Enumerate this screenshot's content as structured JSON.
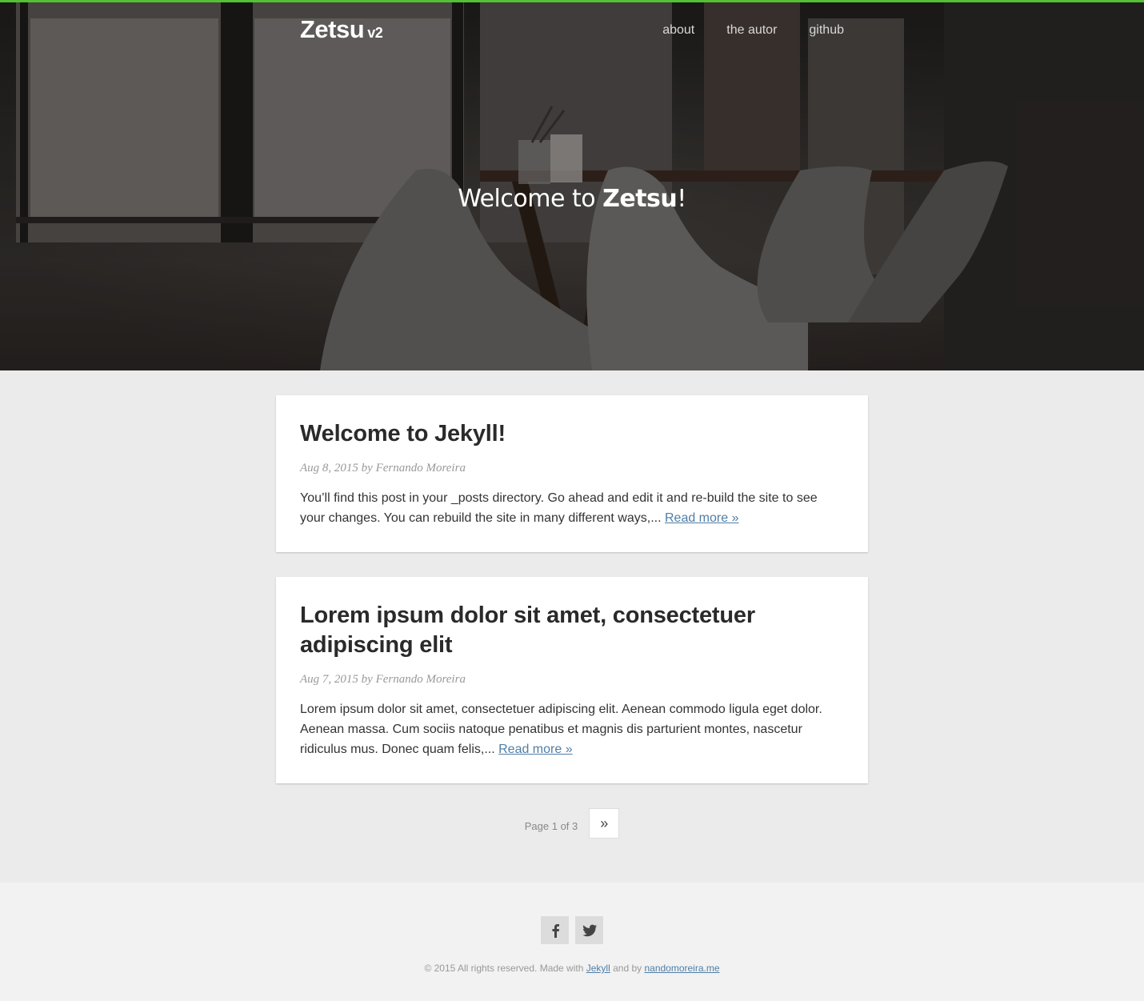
{
  "header": {
    "brand_name": "Zetsu",
    "brand_version": "v2",
    "nav": [
      "about",
      "the autor",
      "github"
    ]
  },
  "hero": {
    "prefix": "Welcome to ",
    "name": "Zetsu",
    "suffix": "!"
  },
  "posts": [
    {
      "title": "Welcome to Jekyll!",
      "date": "Aug 8, 2015",
      "author_prefix": "by",
      "author": "Fernando Moreira",
      "excerpt": "You’ll find this post in your _posts directory. Go ahead and edit it and re-build the site to see your changes. You can rebuild the site in many different ways,...",
      "read_more": "Read more »"
    },
    {
      "title": "Lorem ipsum dolor sit amet, consectetuer adipiscing elit",
      "date": "Aug 7, 2015",
      "author_prefix": "by",
      "author": "Fernando Moreira",
      "excerpt": "Lorem ipsum dolor sit amet, consectetuer adipiscing elit. Aenean commodo ligula eget dolor. Aenean massa. Cum sociis natoque penatibus et magnis dis parturient montes, nascetur ridiculus mus. Donec quam felis,...",
      "read_more": "Read more »"
    }
  ],
  "pagination": {
    "label": "Page 1 of 3",
    "next": "»"
  },
  "footer": {
    "social": [
      {
        "icon": "facebook-icon",
        "glyph": "f"
      },
      {
        "icon": "twitter-icon",
        "glyph": "t"
      }
    ],
    "copyright_prefix": "© 2015 All rights reserved. Made with",
    "jekyll_link": "Jekyll",
    "and_by": "and by",
    "author_link": "nandomoreira.me"
  },
  "colors": {
    "accent": "#53c232",
    "link": "#4f7ea6",
    "background": "#ebebeb",
    "footer_bg": "#f2f2f2"
  }
}
